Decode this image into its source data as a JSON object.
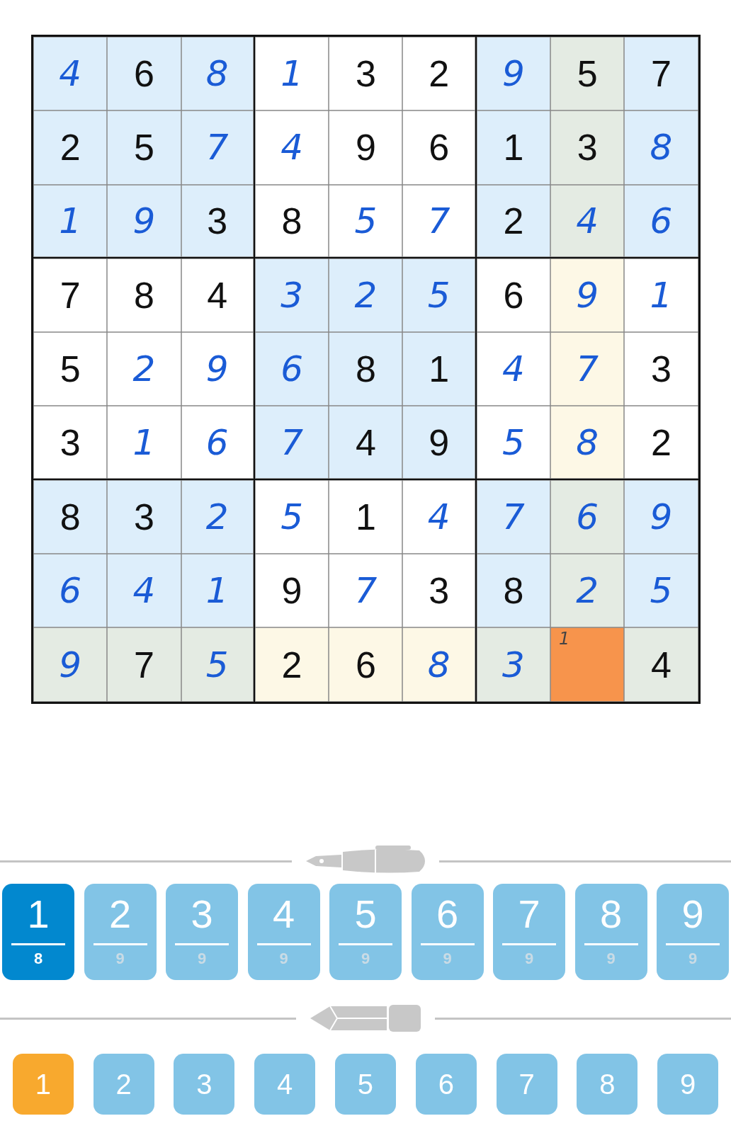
{
  "grid": {
    "rows": [
      [
        {
          "digit": "4",
          "given": false,
          "color": "#ddeefb"
        },
        {
          "digit": "6",
          "given": true,
          "color": "#ddeefb"
        },
        {
          "digit": "8",
          "given": false,
          "color": "#ddeefb"
        },
        {
          "digit": "1",
          "given": false,
          "color": "#ffffff"
        },
        {
          "digit": "3",
          "given": true,
          "color": "#ffffff"
        },
        {
          "digit": "2",
          "given": true,
          "color": "#ffffff"
        },
        {
          "digit": "9",
          "given": false,
          "color": "#ddeefb"
        },
        {
          "digit": "5",
          "given": true,
          "color": "#e4ebe3"
        },
        {
          "digit": "7",
          "given": true,
          "color": "#ddeefb"
        }
      ],
      [
        {
          "digit": "2",
          "given": true,
          "color": "#ddeefb"
        },
        {
          "digit": "5",
          "given": true,
          "color": "#ddeefb"
        },
        {
          "digit": "7",
          "given": false,
          "color": "#ddeefb"
        },
        {
          "digit": "4",
          "given": false,
          "color": "#ffffff"
        },
        {
          "digit": "9",
          "given": true,
          "color": "#ffffff"
        },
        {
          "digit": "6",
          "given": true,
          "color": "#ffffff"
        },
        {
          "digit": "1",
          "given": true,
          "color": "#ddeefb"
        },
        {
          "digit": "3",
          "given": true,
          "color": "#e4ebe3"
        },
        {
          "digit": "8",
          "given": false,
          "color": "#ddeefb"
        }
      ],
      [
        {
          "digit": "1",
          "given": false,
          "color": "#ddeefb"
        },
        {
          "digit": "9",
          "given": false,
          "color": "#ddeefb"
        },
        {
          "digit": "3",
          "given": true,
          "color": "#ddeefb"
        },
        {
          "digit": "8",
          "given": true,
          "color": "#ffffff"
        },
        {
          "digit": "5",
          "given": false,
          "color": "#ffffff"
        },
        {
          "digit": "7",
          "given": false,
          "color": "#ffffff"
        },
        {
          "digit": "2",
          "given": true,
          "color": "#ddeefb"
        },
        {
          "digit": "4",
          "given": false,
          "color": "#e4ebe3"
        },
        {
          "digit": "6",
          "given": false,
          "color": "#ddeefb"
        }
      ],
      [
        {
          "digit": "7",
          "given": true,
          "color": "#ffffff"
        },
        {
          "digit": "8",
          "given": true,
          "color": "#ffffff"
        },
        {
          "digit": "4",
          "given": true,
          "color": "#ffffff"
        },
        {
          "digit": "3",
          "given": false,
          "color": "#ddeefb"
        },
        {
          "digit": "2",
          "given": false,
          "color": "#ddeefb"
        },
        {
          "digit": "5",
          "given": false,
          "color": "#ddeefb"
        },
        {
          "digit": "6",
          "given": true,
          "color": "#ffffff"
        },
        {
          "digit": "9",
          "given": false,
          "color": "#fdf8e6"
        },
        {
          "digit": "1",
          "given": false,
          "color": "#ffffff"
        }
      ],
      [
        {
          "digit": "5",
          "given": true,
          "color": "#ffffff"
        },
        {
          "digit": "2",
          "given": false,
          "color": "#ffffff"
        },
        {
          "digit": "9",
          "given": false,
          "color": "#ffffff"
        },
        {
          "digit": "6",
          "given": false,
          "color": "#ddeefb"
        },
        {
          "digit": "8",
          "given": true,
          "color": "#ddeefb"
        },
        {
          "digit": "1",
          "given": true,
          "color": "#ddeefb"
        },
        {
          "digit": "4",
          "given": false,
          "color": "#ffffff"
        },
        {
          "digit": "7",
          "given": false,
          "color": "#fdf8e6"
        },
        {
          "digit": "3",
          "given": true,
          "color": "#ffffff"
        }
      ],
      [
        {
          "digit": "3",
          "given": true,
          "color": "#ffffff"
        },
        {
          "digit": "1",
          "given": false,
          "color": "#ffffff"
        },
        {
          "digit": "6",
          "given": false,
          "color": "#ffffff"
        },
        {
          "digit": "7",
          "given": false,
          "color": "#ddeefb"
        },
        {
          "digit": "4",
          "given": true,
          "color": "#ddeefb"
        },
        {
          "digit": "9",
          "given": true,
          "color": "#ddeefb"
        },
        {
          "digit": "5",
          "given": false,
          "color": "#ffffff"
        },
        {
          "digit": "8",
          "given": false,
          "color": "#fdf8e6"
        },
        {
          "digit": "2",
          "given": true,
          "color": "#ffffff"
        }
      ],
      [
        {
          "digit": "8",
          "given": true,
          "color": "#ddeefb"
        },
        {
          "digit": "3",
          "given": true,
          "color": "#ddeefb"
        },
        {
          "digit": "2",
          "given": false,
          "color": "#ddeefb"
        },
        {
          "digit": "5",
          "given": false,
          "color": "#ffffff"
        },
        {
          "digit": "1",
          "given": true,
          "color": "#ffffff"
        },
        {
          "digit": "4",
          "given": false,
          "color": "#ffffff"
        },
        {
          "digit": "7",
          "given": false,
          "color": "#ddeefb"
        },
        {
          "digit": "6",
          "given": false,
          "color": "#e4ebe3"
        },
        {
          "digit": "9",
          "given": false,
          "color": "#ddeefb"
        }
      ],
      [
        {
          "digit": "6",
          "given": false,
          "color": "#ddeefb"
        },
        {
          "digit": "4",
          "given": false,
          "color": "#ddeefb"
        },
        {
          "digit": "1",
          "given": false,
          "color": "#ddeefb"
        },
        {
          "digit": "9",
          "given": true,
          "color": "#ffffff"
        },
        {
          "digit": "7",
          "given": false,
          "color": "#ffffff"
        },
        {
          "digit": "3",
          "given": true,
          "color": "#ffffff"
        },
        {
          "digit": "8",
          "given": true,
          "color": "#ddeefb"
        },
        {
          "digit": "2",
          "given": false,
          "color": "#e4ebe3"
        },
        {
          "digit": "5",
          "given": false,
          "color": "#ddeefb"
        }
      ],
      [
        {
          "digit": "9",
          "given": false,
          "color": "#e4ebe3"
        },
        {
          "digit": "7",
          "given": true,
          "color": "#e4ebe3"
        },
        {
          "digit": "5",
          "given": false,
          "color": "#e4ebe3"
        },
        {
          "digit": "2",
          "given": true,
          "color": "#fdf8e6"
        },
        {
          "digit": "6",
          "given": true,
          "color": "#fdf8e6"
        },
        {
          "digit": "8",
          "given": false,
          "color": "#fdf8e6"
        },
        {
          "digit": "3",
          "given": false,
          "color": "#e4ebe3"
        },
        {
          "notes": [
            "1"
          ],
          "color": "#f7944c"
        },
        {
          "digit": "4",
          "given": true,
          "color": "#e4ebe3"
        }
      ]
    ]
  },
  "pen_pad": [
    {
      "digit": "1",
      "count": "8",
      "selected": true
    },
    {
      "digit": "2",
      "count": "9",
      "selected": false
    },
    {
      "digit": "3",
      "count": "9",
      "selected": false
    },
    {
      "digit": "4",
      "count": "9",
      "selected": false
    },
    {
      "digit": "5",
      "count": "9",
      "selected": false
    },
    {
      "digit": "6",
      "count": "9",
      "selected": false
    },
    {
      "digit": "7",
      "count": "9",
      "selected": false
    },
    {
      "digit": "8",
      "count": "9",
      "selected": false
    },
    {
      "digit": "9",
      "count": "9",
      "selected": false
    }
  ],
  "pencil_pad": [
    {
      "digit": "1",
      "selected": true
    },
    {
      "digit": "2",
      "selected": false
    },
    {
      "digit": "3",
      "selected": false
    },
    {
      "digit": "4",
      "selected": false
    },
    {
      "digit": "5",
      "selected": false
    },
    {
      "digit": "6",
      "selected": false
    },
    {
      "digit": "7",
      "selected": false
    },
    {
      "digit": "8",
      "selected": false
    },
    {
      "digit": "9",
      "selected": false
    }
  ]
}
